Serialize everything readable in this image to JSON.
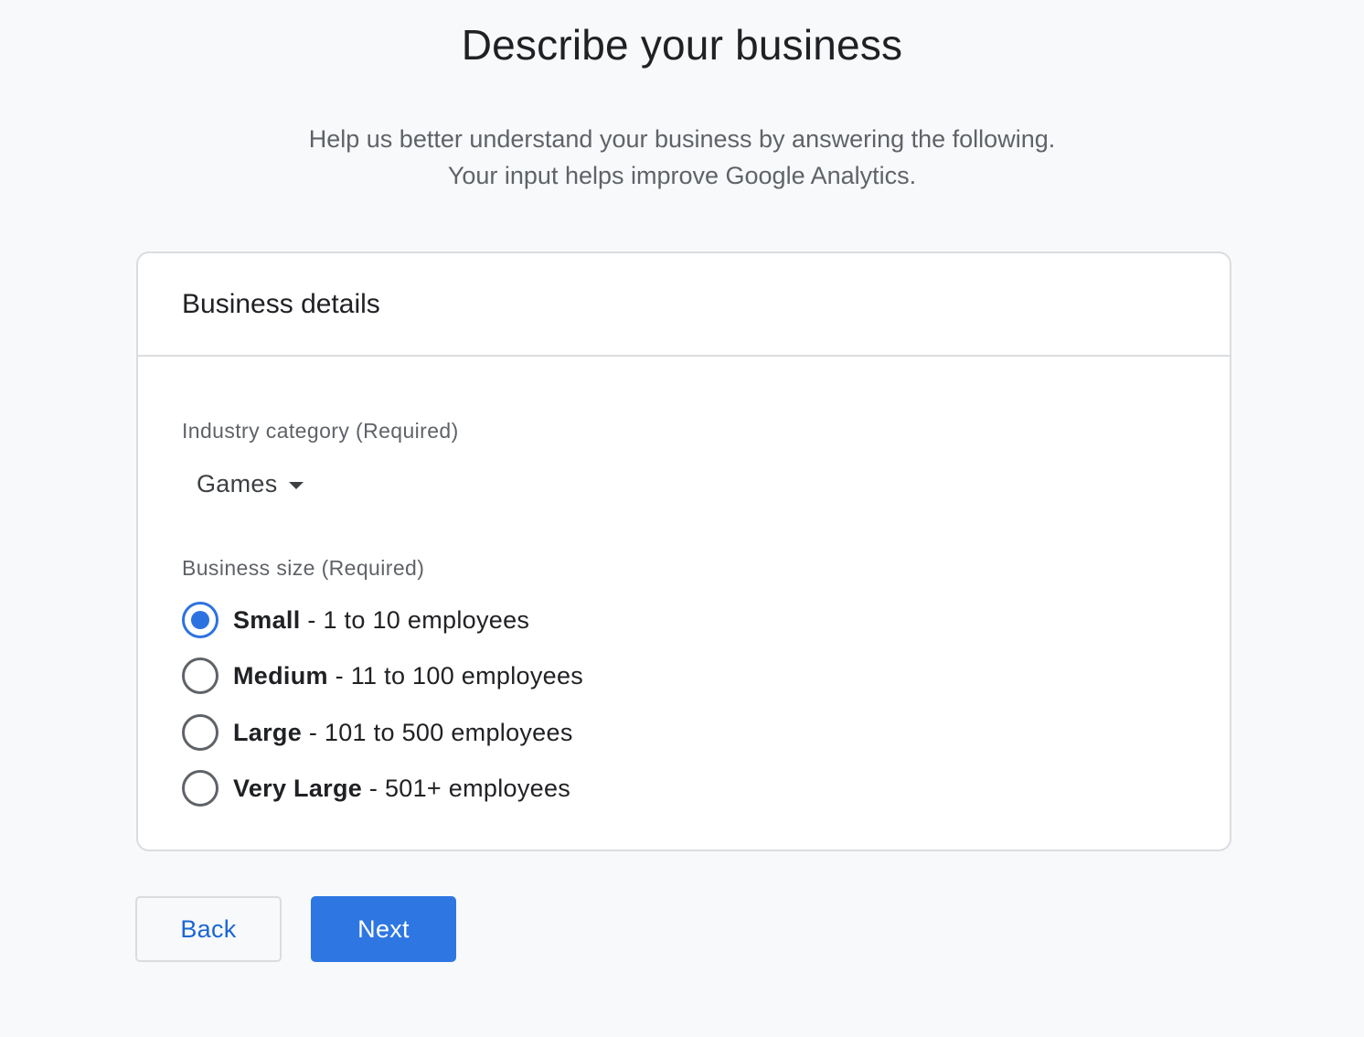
{
  "header": {
    "title": "Describe your business",
    "subtitle_line1": "Help us better understand your business by answering the following.",
    "subtitle_line2": "Your input helps improve Google Analytics."
  },
  "card": {
    "title": "Business details",
    "industry": {
      "label": "Industry category (Required)",
      "selected": "Games"
    },
    "size": {
      "label": "Business size (Required)",
      "options": [
        {
          "name": "Small",
          "detail": " - 1 to 10 employees",
          "checked": true
        },
        {
          "name": "Medium",
          "detail": " - 11 to 100 employees",
          "checked": false
        },
        {
          "name": "Large",
          "detail": " - 101 to 500 employees",
          "checked": false
        },
        {
          "name": "Very Large",
          "detail": " - 501+ employees",
          "checked": false
        }
      ]
    }
  },
  "buttons": {
    "back": "Back",
    "next": "Next"
  },
  "colors": {
    "accent": "#2e77e2",
    "link": "#1a67d2",
    "border": "#dadce0",
    "background": "#f8f9fa"
  },
  "icons": {
    "dropdown": "caret-down-icon",
    "radio_checked": "radio-checked-icon",
    "radio_unchecked": "radio-unchecked-icon"
  }
}
